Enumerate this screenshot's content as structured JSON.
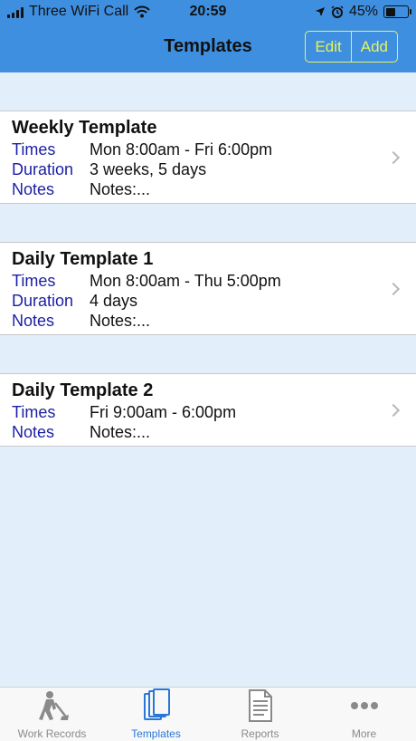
{
  "status_bar": {
    "carrier": "Three WiFi Call",
    "time": "20:59",
    "battery": "45%",
    "battery_level": 0.45
  },
  "nav": {
    "title": "Templates",
    "edit_label": "Edit",
    "add_label": "Add"
  },
  "templates": [
    {
      "title": "Weekly Template",
      "times_label": "Times",
      "times": "Mon 8:00am - Fri 6:00pm",
      "duration_label": "Duration",
      "duration": "3 weeks, 5 days",
      "notes_label": "Notes",
      "notes": "Notes:..."
    },
    {
      "title": "Daily Template 1",
      "times_label": "Times",
      "times": "Mon 8:00am - Thu 5:00pm",
      "duration_label": "Duration",
      "duration": "4 days",
      "notes_label": "Notes",
      "notes": "Notes:..."
    },
    {
      "title": "Daily Template 2",
      "times_label": "Times",
      "times": "Fri 9:00am - 6:00pm",
      "notes_label": "Notes",
      "notes": "Notes:..."
    }
  ],
  "tabs": [
    {
      "label": "Work Records",
      "icon": "worker-icon"
    },
    {
      "label": "Templates",
      "icon": "templates-icon",
      "active": true
    },
    {
      "label": "Reports",
      "icon": "document-icon"
    },
    {
      "label": "More",
      "icon": "more-icon"
    }
  ],
  "colors": {
    "nav_bar": "#3f8fe0",
    "nav_button": "#e6f35c",
    "background": "#e3eefb",
    "field_label": "#1b1fa3",
    "tab_active": "#2a77d8",
    "tab_inactive": "#8a8a8a"
  }
}
